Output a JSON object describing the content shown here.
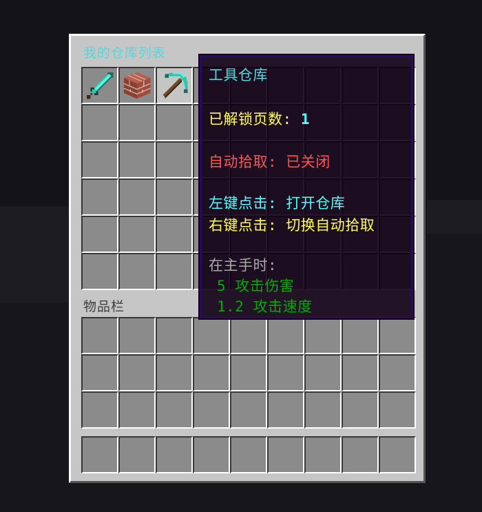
{
  "panel": {
    "title": "我的仓库列表",
    "inventory_label": "物品栏"
  },
  "storage_slots": [
    {
      "item": "diamond-sword-icon"
    },
    {
      "item": "brick-block-icon"
    },
    {
      "item": "diamond-pickaxe-icon"
    }
  ],
  "tooltip": {
    "name": "工具仓库",
    "pages_label": "已解锁页数:",
    "pages_value": "1",
    "auto_pickup": "自动拾取: 已关闭",
    "left_click": "左键点击: 打开仓库",
    "right_click": "右键点击: 切换自动拾取",
    "main_hand": "在主手时:",
    "attack_damage": "5 攻击伤害",
    "attack_speed": "1.2 攻击速度"
  },
  "colors": {
    "panel": "#c6c6c6",
    "slot": "#8b8b8b",
    "title": "#55d8d8",
    "tooltip_bg": "#100014",
    "tooltip_border": "#2a0a5a",
    "yellow": "#ffff55",
    "aqua": "#55ffff",
    "red": "#ff5555",
    "gray": "#aaaaaa",
    "green": "#00aa00"
  }
}
